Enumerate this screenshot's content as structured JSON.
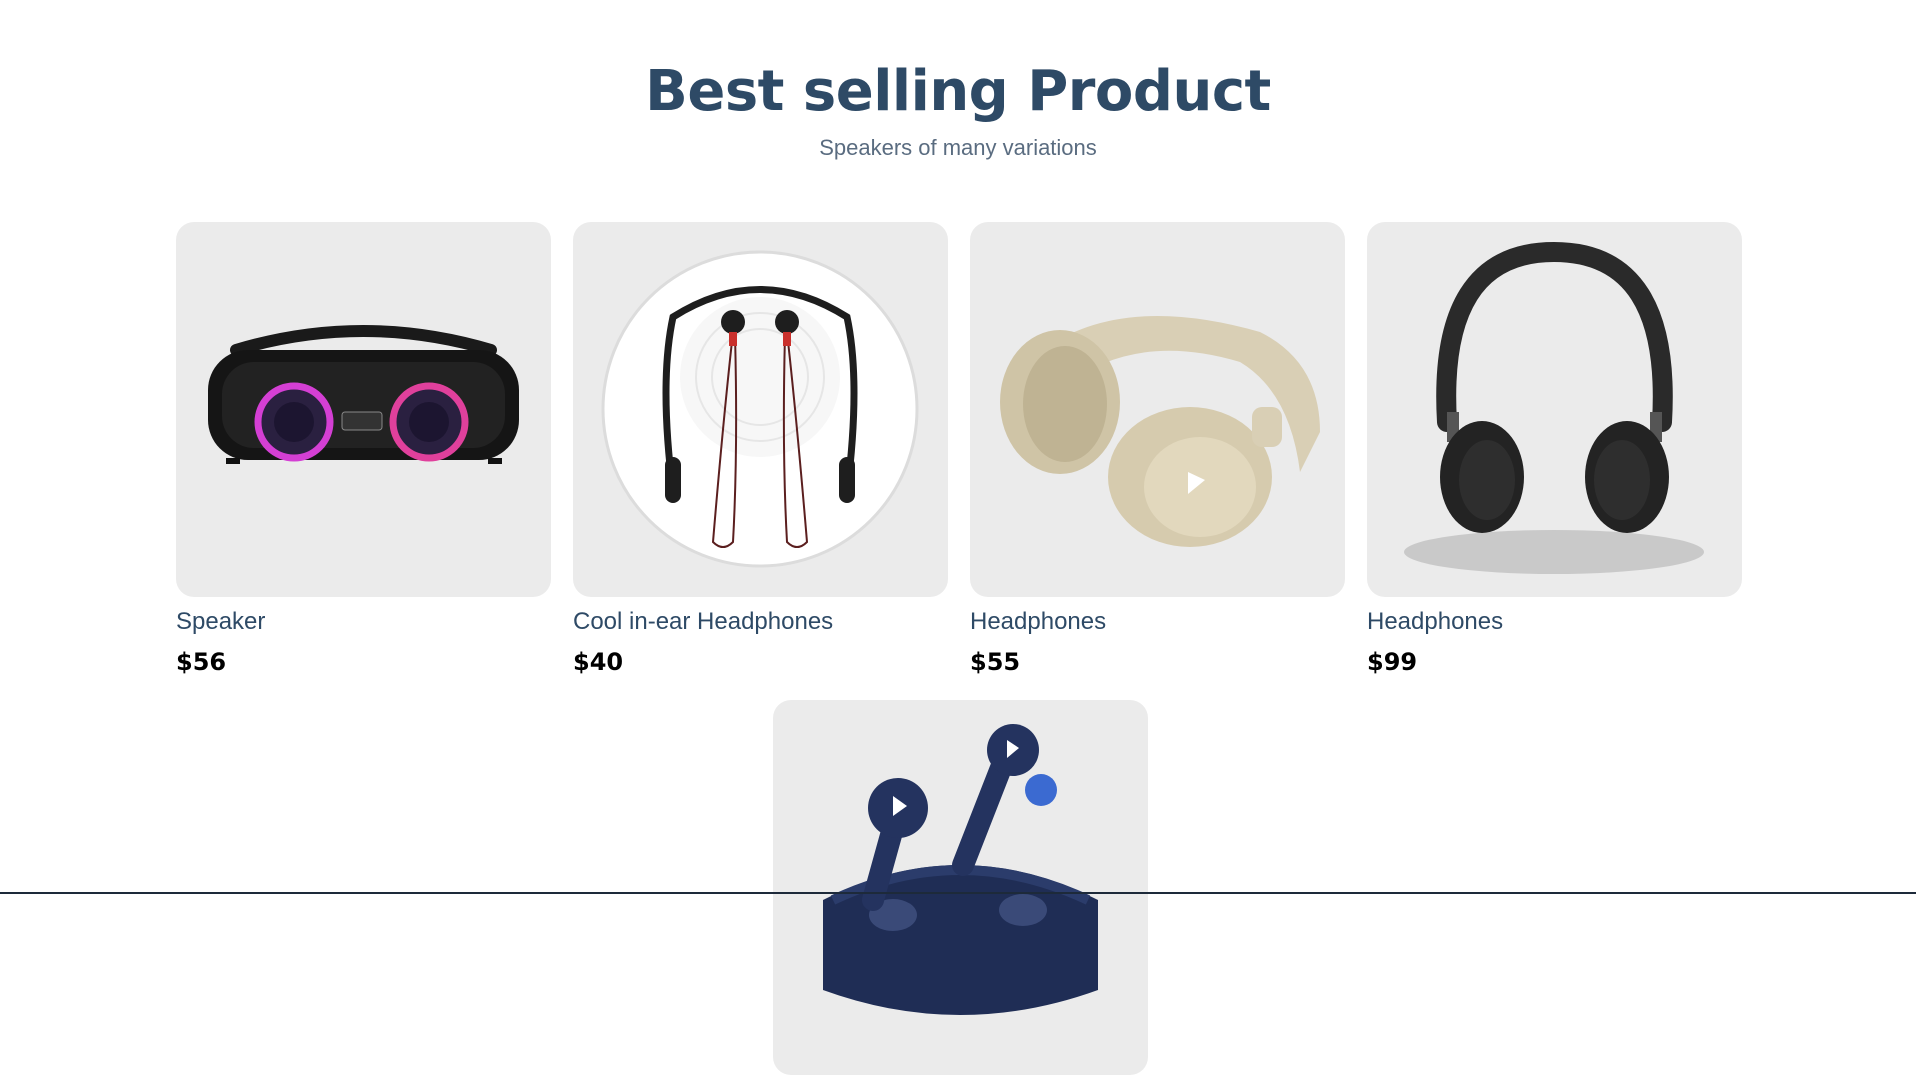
{
  "section": {
    "title": "Best selling Product",
    "subtitle": "Speakers of many variations"
  },
  "products": [
    {
      "name": "Speaker",
      "price": "$56",
      "image_icon": "boombox-speaker-icon"
    },
    {
      "name": "Cool in-ear Headphones",
      "price": "$40",
      "image_icon": "neckband-earphones-icon"
    },
    {
      "name": "Headphones",
      "price": "$55",
      "image_icon": "beige-headphones-icon"
    },
    {
      "name": "Headphones",
      "price": "$99",
      "image_icon": "black-headphones-icon"
    },
    {
      "name": "",
      "price": "",
      "image_icon": "earbuds-case-icon"
    }
  ],
  "colors": {
    "title": "#2e4a66",
    "subtitle": "#5a6c80",
    "card_bg": "#ebebeb",
    "price": "#000000"
  }
}
